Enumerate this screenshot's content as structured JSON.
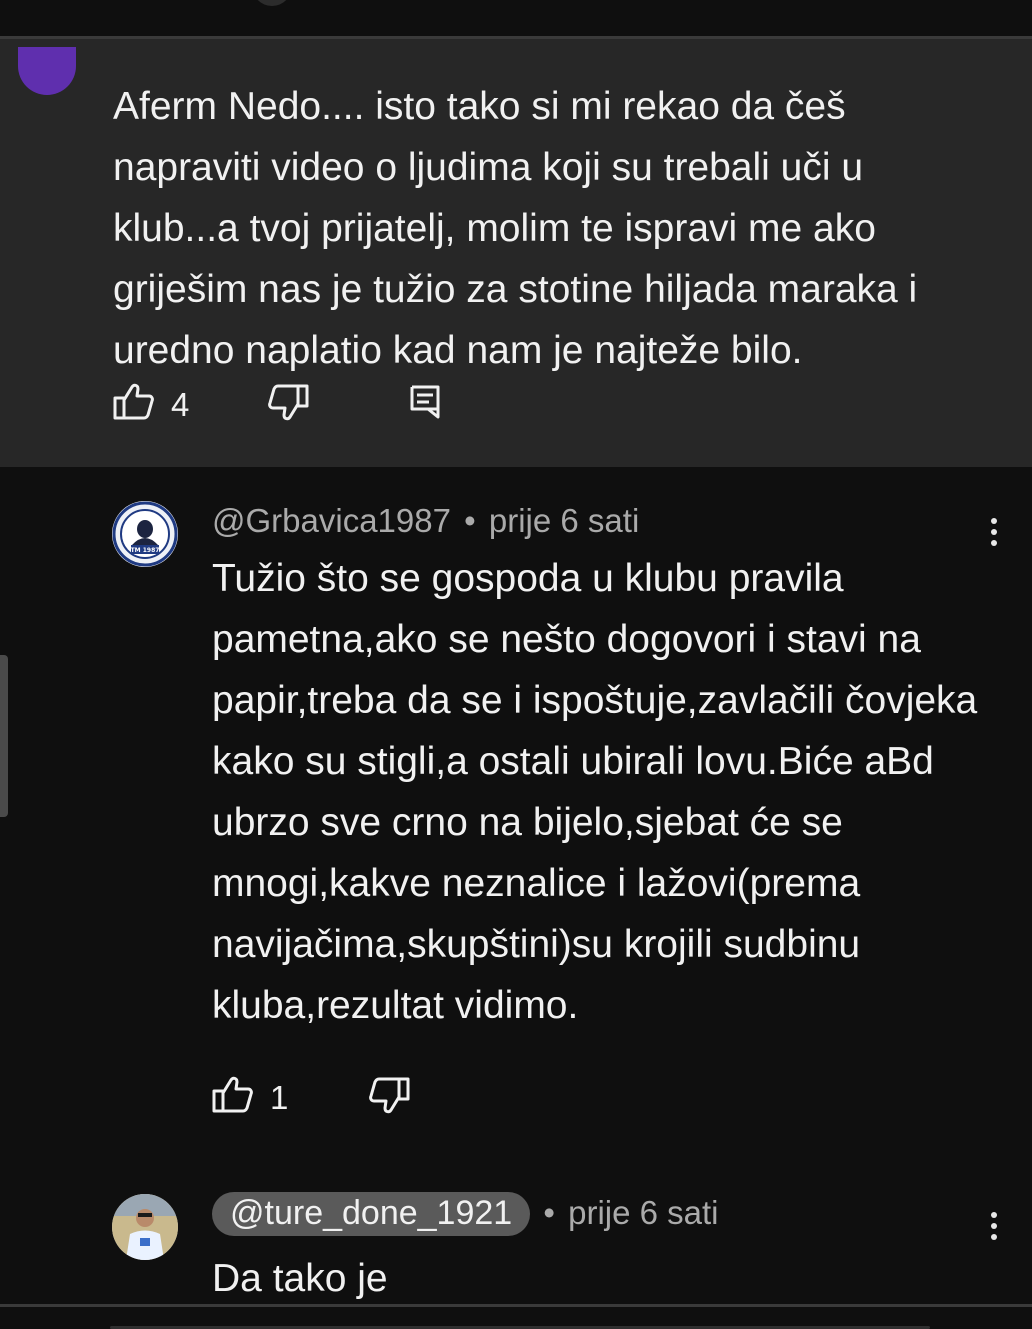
{
  "comment_main": {
    "text": "Aferm Nedo.... isto tako si mi rekao da češ napraviti video o ljudima koji su trebali uči u klub...a tvoj prijatelj, molim te ispravi me ako griješim nas je tužio za stotine hiljada maraka i uredno naplatio kad nam je najteže bilo.",
    "likes": "4",
    "icons": {
      "like": "thumb-up-icon",
      "dislike": "thumb-down-icon",
      "reply": "reply-icon"
    }
  },
  "reply_1": {
    "handle": "@Grbavica1987",
    "separator": "•",
    "time": "prije 6 sati",
    "text": "Tužio što se gospoda u klubu pravila pametna,ako se nešto dogovori i stavi na papir,treba da se i ispoštuje,zavlačili čovjeka kako su stigli,a ostali ubirali lovu.Biće aBd ubrzo sve crno na bijelo,sjebat će se mnogi,kakve neznalice i  lažovi(prema navijačima,skupštini)su krojili sudbinu kluba,rezultat vidimo.",
    "likes": "1",
    "avatar_badge": "TM 1987"
  },
  "reply_2": {
    "handle": "@ture_done_1921",
    "separator": "•",
    "time": "prije 6 sati",
    "text": "Da tako je"
  },
  "colors": {
    "background": "#0f0f0f",
    "highlight": "#272727",
    "text": "#f1f1f1",
    "meta": "#aaaaaa",
    "handle_pill": "#5a5a5a",
    "purple_avatar": "#5f2fae"
  }
}
